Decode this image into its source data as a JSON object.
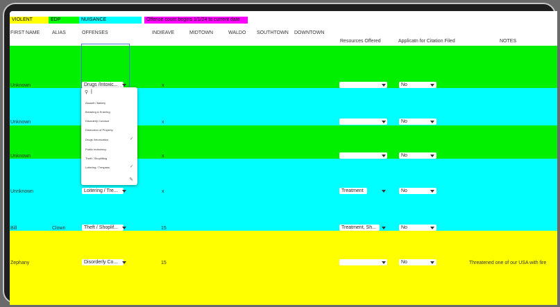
{
  "legend": {
    "violent": "VIOLENT",
    "edp": "EDP",
    "nuisance": "NUISANCE",
    "note": "Offense count begins 1/1/24 to current date"
  },
  "headers": {
    "first_name": "FIRST NAME",
    "alias": "ALIAS",
    "offenses": "OFFENSES",
    "indieave": "INDIEAVE",
    "midtown": "MIDTOWN",
    "waldo": "WALDO",
    "southtown": "SOUTHTOWN",
    "downtown": "DOWNTOWN",
    "resources": "Resources Offered",
    "citation": "Applicatn for Citation Filed",
    "notes": "NOTES"
  },
  "rows": [
    {
      "name": "Unknown",
      "alias": "",
      "offense": "Drugs /Intoxic...",
      "indieave": "x",
      "resources": "",
      "citation": "No",
      "notes": ""
    },
    {
      "name": "Unknown",
      "alias": "",
      "offense": "",
      "indieave": "x",
      "resources": "",
      "citation": "No",
      "notes": ""
    },
    {
      "name": "Unknown",
      "alias": "",
      "offense": "",
      "indieave": "x",
      "resources": "",
      "citation": "No",
      "notes": ""
    },
    {
      "name": "Unnknown",
      "alias": "",
      "offense": "Loitering / Tre...",
      "indieave": "x",
      "resources": "Treatment",
      "citation": "No",
      "notes": ""
    },
    {
      "name": "Bill",
      "alias": "Clown",
      "offense": "Theft / Shoplif...",
      "indieave": "15",
      "resources": "Treatment, Sh...",
      "citation": "No",
      "notes": ""
    },
    {
      "name": "Zephany",
      "alias": "",
      "offense": "Disorderly Co...",
      "indieave": "15",
      "resources": "",
      "citation": "No",
      "notes": "Threatened one of our USA with fire"
    }
  ],
  "dropdown": {
    "search_placeholder": "",
    "options": [
      {
        "label": "Assault / Battery",
        "checked": false
      },
      {
        "label": "Breaking & Entering",
        "checked": false
      },
      {
        "label": "Disorderly Conduct",
        "checked": false
      },
      {
        "label": "Distruction of Property",
        "checked": false
      },
      {
        "label": "Drugs /Intoxication",
        "checked": true
      },
      {
        "label": "Public Indecency",
        "checked": false
      },
      {
        "label": "Theft / Shoplifting",
        "checked": false
      },
      {
        "label": "Loitering / Trespass",
        "checked": true
      }
    ]
  },
  "colors": {
    "violent": "#ffff00",
    "edp": "#00ff00",
    "nuisance": "#00ffff",
    "note": "#ff00ff",
    "green_row": "#00f000",
    "cyan_row": "#00ffff",
    "yellow_row": "#ffff00",
    "select_border": "#4a7bd0"
  },
  "icons": {
    "search": "search-icon",
    "check": "check-icon",
    "edit": "pencil-icon",
    "dropdown": "chevron-down-icon"
  }
}
